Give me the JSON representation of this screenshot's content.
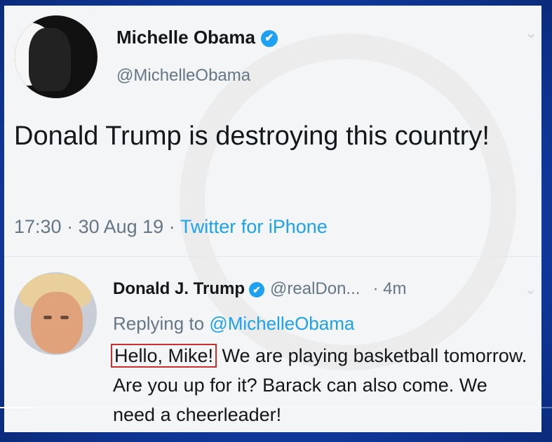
{
  "tweet": {
    "author_name": "Michelle Obama",
    "author_handle": "@MichelleObama",
    "text": "Donald Trump is destroying this country!",
    "time": "17:30",
    "date": "30 Aug 19",
    "source": "Twitter for iPhone",
    "separator": " · "
  },
  "reply": {
    "author_name": "Donald J. Trump",
    "author_handle": "@realDon...",
    "relative_time": "· 4m",
    "replying_prefix": "Replying to ",
    "replying_to": "@MichelleObama",
    "highlighted_text": "Hello, Mike!",
    "text_rest": " We are playing basketball tomorrow. Are you up for it? Barack can also come. We need a cheerleader!"
  },
  "icons": {
    "verified": "✔",
    "chevron": "⌄"
  },
  "video": {
    "progress": 0.06
  },
  "colors": {
    "accent": "#1da1f2",
    "highlight_box": "#c8302d",
    "background": "#123ea8"
  }
}
